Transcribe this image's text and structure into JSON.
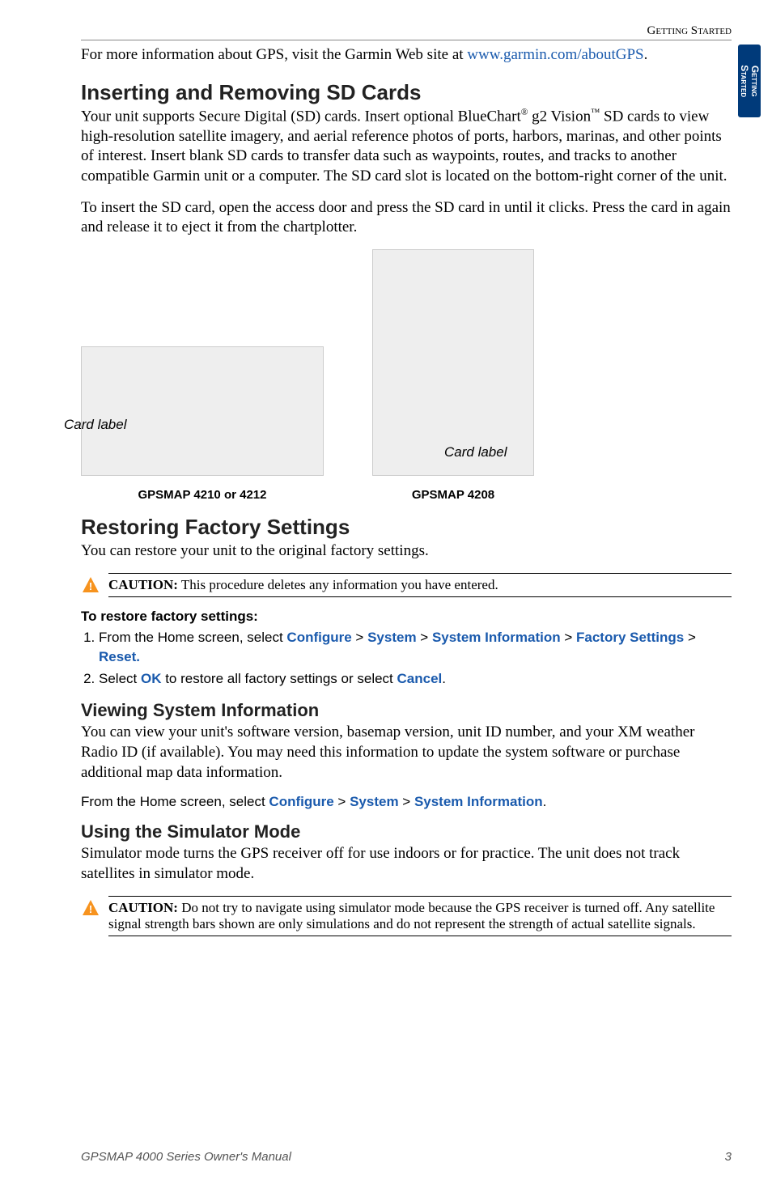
{
  "header": {
    "section": "Getting Started"
  },
  "sideTab": {
    "line1": "Getting",
    "line2": "Started"
  },
  "intro": {
    "prefix": "For more information about GPS, visit the Garmin Web site at ",
    "link": "www.garmin.com/aboutGPS",
    "suffix": "."
  },
  "sd": {
    "title": "Inserting and Removing SD Cards",
    "p1a": "Your unit supports Secure Digital (SD) cards. Insert optional BlueChart",
    "p1b": " g2 Vision",
    "p1c": " SD cards to view high-resolution satellite imagery, and aerial reference photos of ports, harbors, marinas, and other points of interest. Insert blank SD cards to transfer data such as waypoints, routes, and tracks to another compatible Garmin unit or a computer. The SD card slot is located on the bottom-right corner of the unit.",
    "p2": "To insert the SD card, open the access door and press the SD card in until it clicks. Press the card in again and release it to eject it from the chartplotter.",
    "fig1Label": "Card label",
    "fig1Caption": "GPSMAP 4210 or 4212",
    "fig2Label": "Card label",
    "fig2Caption": "GPSMAP 4208"
  },
  "restore": {
    "title": "Restoring Factory Settings",
    "intro": "You can restore your unit to the original factory settings.",
    "cautionLabel": "CAUTION:",
    "cautionText": " This procedure deletes any information you have entered.",
    "stepsTitle": "To restore factory settings:",
    "step1_pre": "From the Home screen, select ",
    "kw_configure": "Configure",
    "sep": " > ",
    "kw_system": "System",
    "kw_sysinfo": "System Information",
    "kw_factory": "Factory Settings",
    "kw_reset": "Reset.",
    "step2_pre": "Select ",
    "kw_ok": "OK",
    "step2_mid": " to restore all factory settings or select ",
    "kw_cancel": "Cancel",
    "step2_end": "."
  },
  "sysinfo": {
    "title": "Viewing System Information",
    "body": "You can view your unit's software version, basemap version, unit ID number, and your XM weather Radio ID (if available). You may need this information to update the system software or purchase additional map data information.",
    "instr_pre": "From the Home screen, select ",
    "instr_end": "."
  },
  "sim": {
    "title": "Using the Simulator Mode",
    "body": "Simulator mode turns the GPS receiver off for use indoors or for practice. The unit does not track satellites in simulator mode.",
    "cautionLabel": "CAUTION:",
    "cautionText": " Do not try to navigate using simulator mode because the GPS receiver is turned off. Any satellite signal strength bars shown are only simulations and do not represent the strength of actual satellite signals."
  },
  "footer": {
    "manual": "GPSMAP 4000 Series Owner's Manual",
    "page": "3"
  }
}
